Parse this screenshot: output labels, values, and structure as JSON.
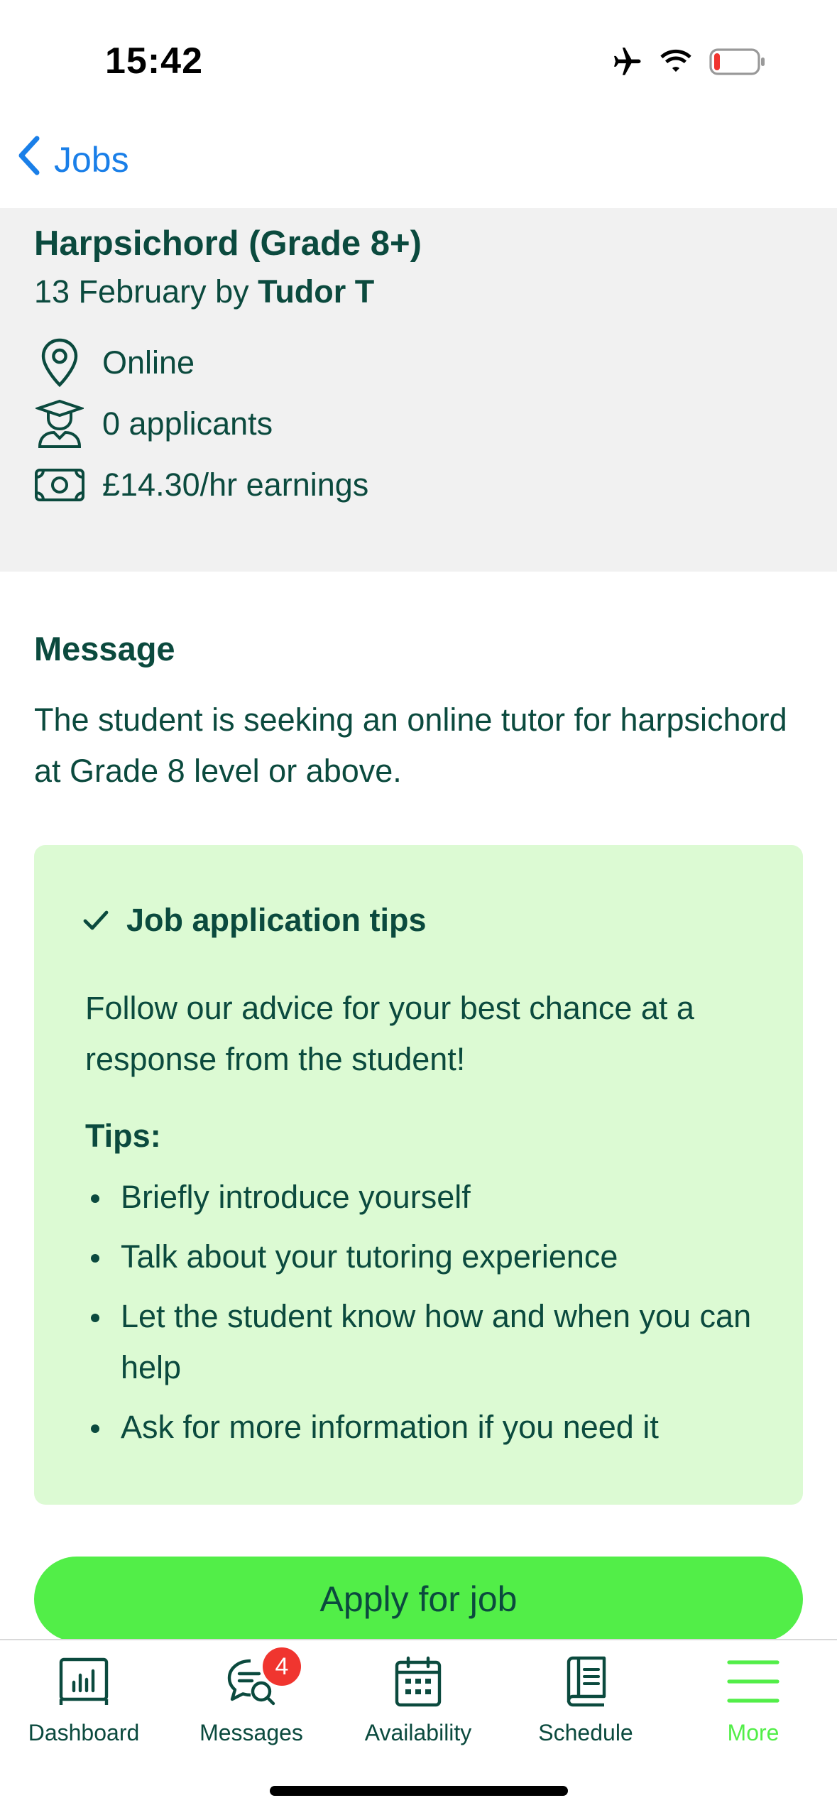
{
  "status_bar": {
    "time": "15:42",
    "icons": [
      "airplane-icon",
      "wifi-icon",
      "battery-icon"
    ],
    "battery_color": "#f0352f"
  },
  "nav": {
    "back_label": "Jobs",
    "accent": "#1a7fe8"
  },
  "job": {
    "title": "Harpsichord (Grade 8+)",
    "date_prefix": "13 February by",
    "author": "Tudor T",
    "details": [
      {
        "icon": "location-pin-icon",
        "text": "Online"
      },
      {
        "icon": "student-icon",
        "text": "0 applicants"
      },
      {
        "icon": "cash-icon",
        "text": "£14.30/hr earnings"
      }
    ]
  },
  "message": {
    "heading": "Message",
    "body": "The student is seeking an online tutor for harpsichord at Grade 8 level or above."
  },
  "tips": {
    "heading": "Job application tips",
    "intro": "Follow our advice for your best chance at a response from the student!",
    "label": "Tips:",
    "items": [
      "Briefly introduce yourself",
      "Talk about your tutoring experience",
      "Let the student know how and when you can help",
      "Ask for more information if you need it"
    ]
  },
  "apply_button": {
    "label": "Apply for job",
    "color": "#52ee48"
  },
  "tab_bar": {
    "tabs": [
      {
        "label": "Dashboard",
        "icon": "dashboard-icon"
      },
      {
        "label": "Messages",
        "icon": "messages-icon",
        "badge": "4"
      },
      {
        "label": "Availability",
        "icon": "calendar-icon"
      },
      {
        "label": "Schedule",
        "icon": "book-icon"
      },
      {
        "label": "More",
        "icon": "menu-icon",
        "active": true
      }
    ]
  },
  "colors": {
    "text": "#0b4a3e",
    "summary_bg": "#f1f1f1",
    "tips_bg": "#dcfad3",
    "active_tab": "#52ee48"
  }
}
